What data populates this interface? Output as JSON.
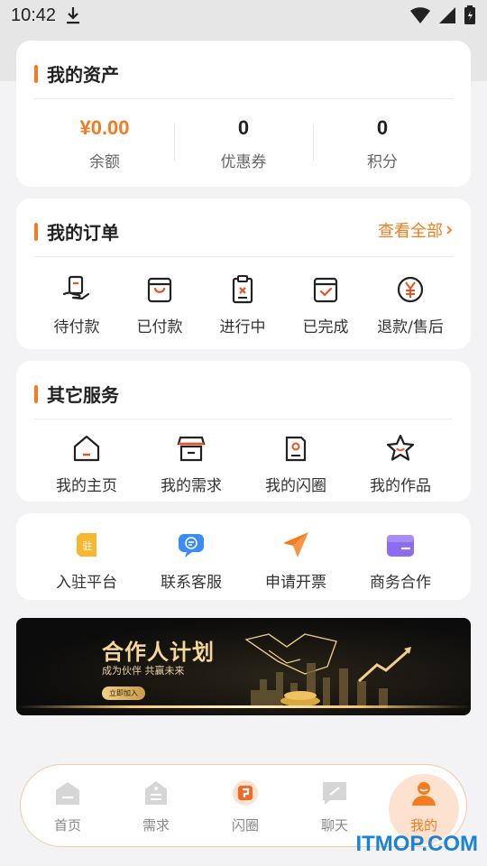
{
  "status": {
    "time": "10:42"
  },
  "assets": {
    "title": "我的资产",
    "items": [
      {
        "value": "¥0.00",
        "label": "余额"
      },
      {
        "value": "0",
        "label": "优惠券"
      },
      {
        "value": "0",
        "label": "积分"
      }
    ]
  },
  "orders": {
    "title": "我的订单",
    "view_all": "查看全部",
    "items": [
      {
        "label": "待付款",
        "icon": "pay-hand-icon"
      },
      {
        "label": "已付款",
        "icon": "bag-icon"
      },
      {
        "label": "进行中",
        "icon": "clipboard-icon"
      },
      {
        "label": "已完成",
        "icon": "bag-check-icon"
      },
      {
        "label": "退款/售后",
        "icon": "yen-circle-icon"
      }
    ]
  },
  "services": {
    "title": "其它服务",
    "items": [
      {
        "label": "我的主页",
        "icon": "home-icon"
      },
      {
        "label": "我的需求",
        "icon": "store-icon"
      },
      {
        "label": "我的闪圈",
        "icon": "photo-card-icon"
      },
      {
        "label": "我的作品",
        "icon": "star-smile-icon"
      }
    ]
  },
  "extras": {
    "items": [
      {
        "label": "入驻平台",
        "icon": "settle-icon",
        "glyph": "驻"
      },
      {
        "label": "联系客服",
        "icon": "chat-icon"
      },
      {
        "label": "申请开票",
        "icon": "send-icon"
      },
      {
        "label": "商务合作",
        "icon": "wallet-icon"
      }
    ]
  },
  "banner": {
    "title": "合作人计划",
    "subtitle": "成为伙伴 共赢未来",
    "button": "立即加入"
  },
  "tabs": [
    {
      "label": "首页",
      "icon": "home-tab-icon"
    },
    {
      "label": "需求",
      "icon": "tag-tab-icon"
    },
    {
      "label": "闪圈",
      "icon": "flash-tab-icon"
    },
    {
      "label": "聊天",
      "icon": "chat-tab-icon"
    },
    {
      "label": "我的",
      "icon": "user-tab-icon"
    }
  ],
  "watermark": "ITMOP.COM",
  "colors": {
    "accent": "#f47b20",
    "background": "#f3f3f5"
  }
}
